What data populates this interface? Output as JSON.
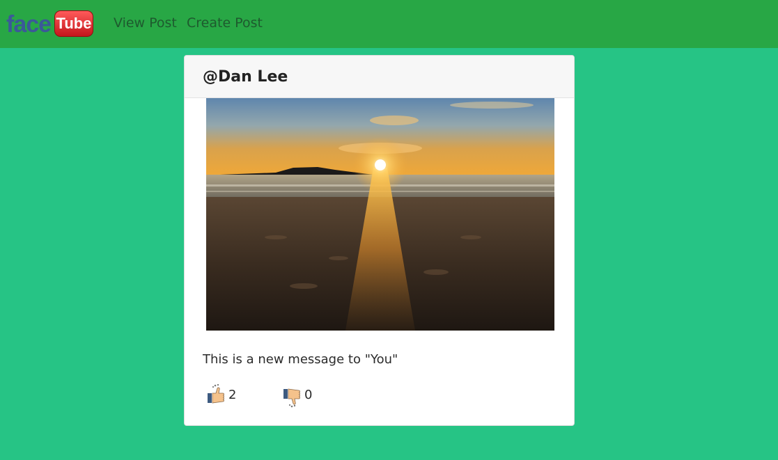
{
  "navbar": {
    "brand": {
      "part1": "face",
      "part2": "Tube"
    },
    "links": [
      {
        "label": "View Post"
      },
      {
        "label": "Create Post"
      }
    ]
  },
  "post": {
    "author": "@Dan Lee",
    "message": "This is a new message to \"You\"",
    "likes": "2",
    "dislikes": "0"
  },
  "icons": {
    "like": "thumbs-up-icon",
    "dislike": "thumbs-down-icon"
  },
  "colors": {
    "page_background": "#26c485",
    "navbar_background": "#28a745",
    "brand_face": "#3b5998",
    "brand_tube": "#d9262c"
  }
}
